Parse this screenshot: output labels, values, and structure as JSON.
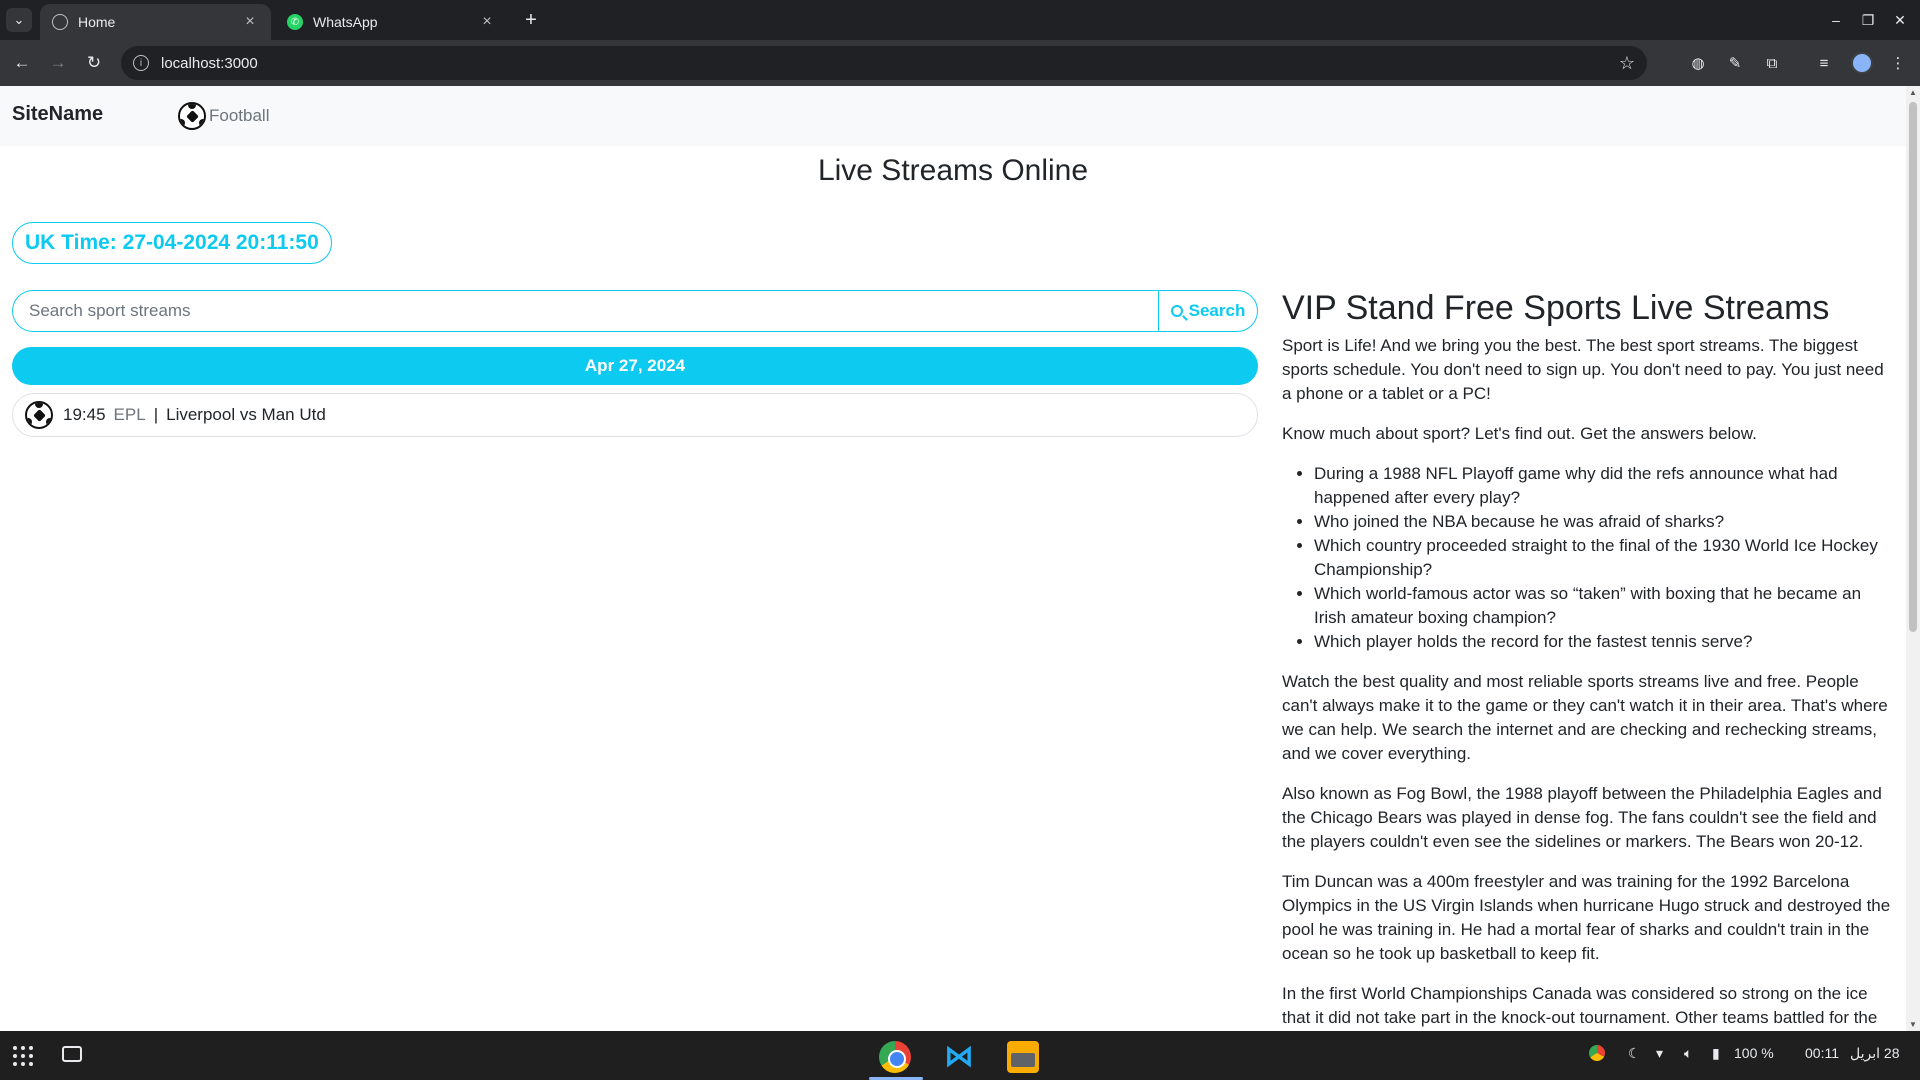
{
  "browser": {
    "tabs": [
      {
        "title": "Home",
        "active": true
      },
      {
        "title": "WhatsApp",
        "active": false
      }
    ],
    "url": "localhost:3000"
  },
  "site": {
    "brand": "SiteName",
    "nav_football": "Football",
    "page_title": "Live Streams Online",
    "uk_time": "UK Time: 27-04-2024 20:11:50",
    "search": {
      "placeholder": "Search sport streams",
      "button_label": "Search"
    },
    "date_header": "Apr 27, 2024",
    "events": [
      {
        "time": "19:45",
        "league": "EPL",
        "separator": "|",
        "match": "Liverpool vs Man Utd"
      }
    ]
  },
  "article": {
    "heading": "VIP Stand Free Sports Live Streams",
    "intro": "Sport is Life! And we bring you the best. The best sport streams. The biggest sports schedule. You don't need to sign up. You don't need to pay. You just need a phone or a tablet or a PC!",
    "quiz_intro": "Know much about sport? Let's find out. Get the answers below.",
    "questions": [
      "During a 1988 NFL Playoff game why did the refs announce what had happened after every play?",
      "Who joined the NBA because he was afraid of sharks?",
      "Which country proceeded straight to the final of the 1930 World Ice Hockey Championship?",
      "Which world-famous actor was so “taken” with boxing that he became an Irish amateur boxing champion?",
      "Which player holds the record for the fastest tennis serve?"
    ],
    "para_quality": "Watch the best quality and most reliable sports streams live and free. People can't always make it to the game or they can't watch it in their area. That's where we can help. We search the internet and are checking and rechecking streams, and we cover everything.",
    "para_fog_bowl": "Also known as Fog Bowl, the 1988 playoff between the Philadelphia Eagles and the Chicago Bears was played in dense fog. The fans couldn't see the field and the players couldn't even see the sidelines or markers. The Bears won 20-12.",
    "para_duncan": "Tim Duncan was a 400m freestyler and was training for the 1992 Barcelona Olympics in the US Virgin Islands when hurricane Hugo struck and destroyed the pool he was training in. He had a mortal fear of sharks and couldn't train in the ocean so he took up basketball to keep fit.",
    "para_canada": "In the first World Championships Canada was considered so strong on the ice that it did not take part in the knock-out tournament. Other teams battled for the"
  },
  "taskbar": {
    "battery": "100 %",
    "time": "00:11",
    "date": "28 ابریل"
  },
  "icons": [
    "globe-icon",
    "whatsapp-icon",
    "soccer-ball-icon",
    "search-icon",
    "star-icon",
    "chrome-icon",
    "vscode-icon",
    "files-icon"
  ],
  "colors": {
    "accent": "#0dcaf0",
    "chrome_dark": "#202124",
    "chrome_toolbar": "#35363a",
    "taskbar": "#1f1f1f"
  }
}
